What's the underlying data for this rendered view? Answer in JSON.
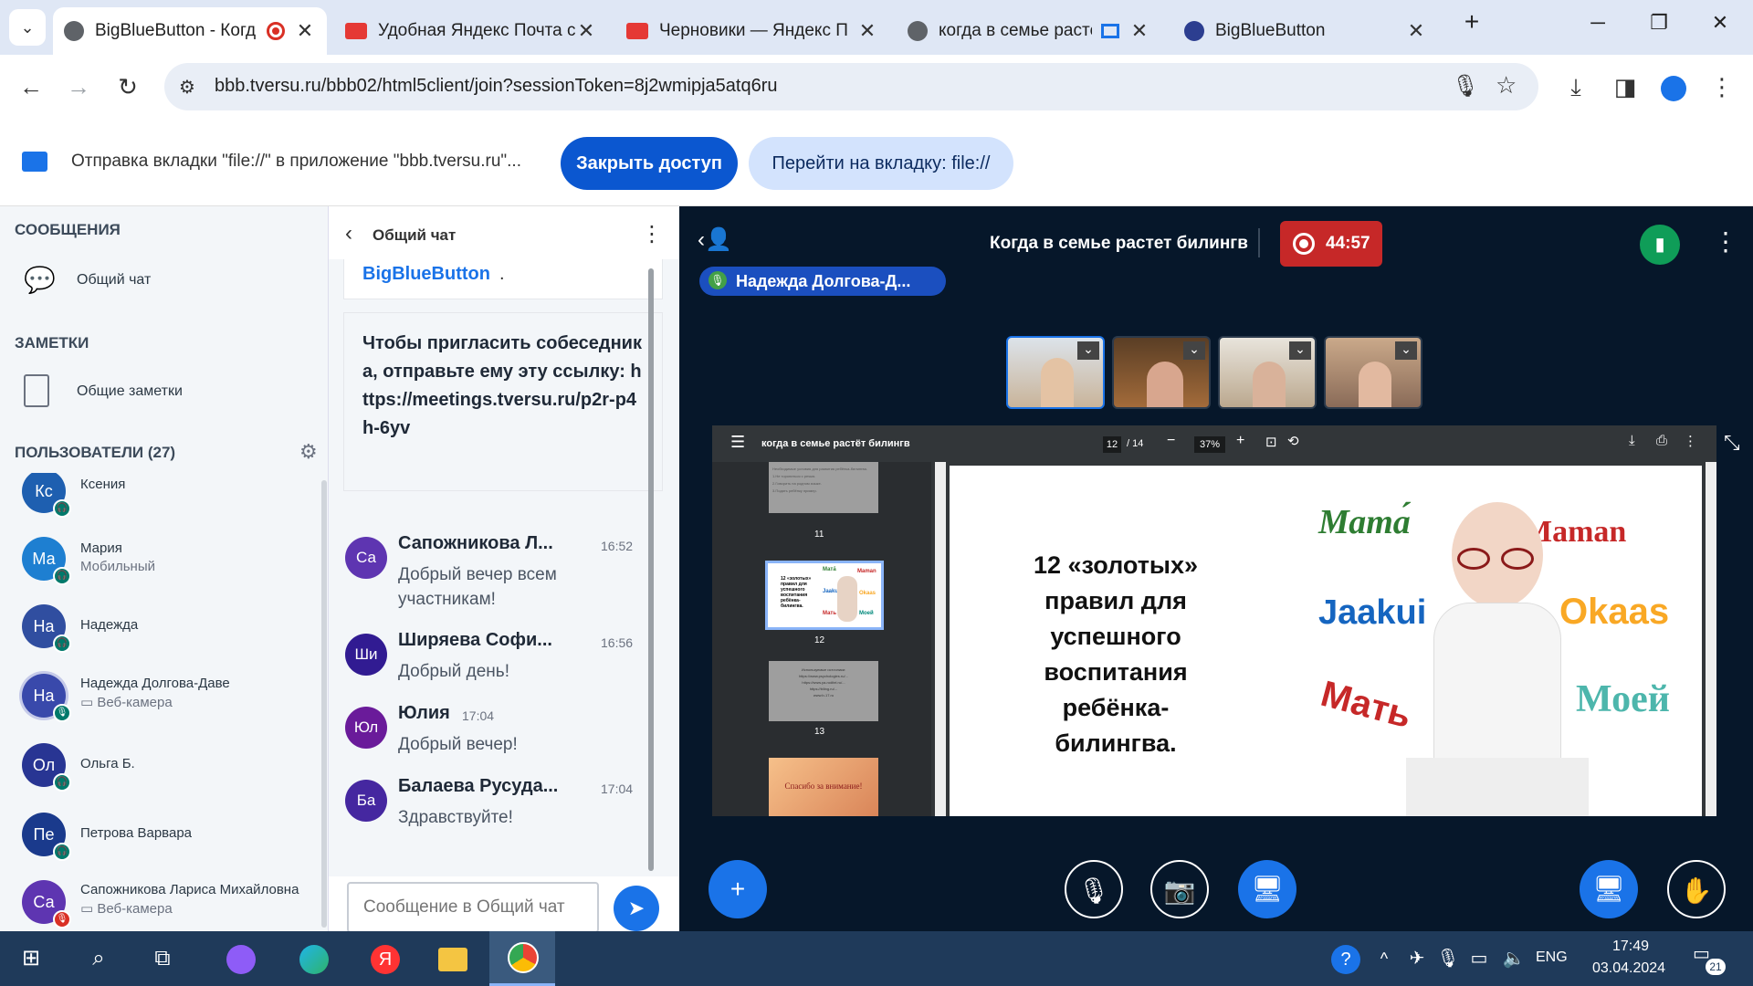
{
  "browser": {
    "tabs": [
      {
        "title": "BigBlueButton - Когд",
        "active": true
      },
      {
        "title": "Удобная Яндекс Почта с"
      },
      {
        "title": "Черновики — Яндекс П"
      },
      {
        "title": "когда в семье растё"
      },
      {
        "title": "BigBlueButton"
      }
    ],
    "url": "bbb.tversu.ru/bbb02/html5client/join?sessionToken=8j2wmipja5atq6ru",
    "new_tab": "+",
    "window_min": "─",
    "window_restore": "❐",
    "window_close": "✕"
  },
  "infobar": {
    "text": "Отправка вкладки \"file://\" в приложение \"bbb.tversu.ru\"...",
    "stop_button": "Закрыть доступ",
    "switch_button": "Перейти на вкладку: file://"
  },
  "sidebar": {
    "messages_title": "СООБЩЕНИЯ",
    "public_chat": "Общий чат",
    "notes_title": "ЗАМЕТКИ",
    "shared_notes": "Общие заметки",
    "users_title": "ПОЛЬЗОВАТЕЛИ (27)",
    "users": [
      {
        "initials": "Кс",
        "name": "Ксения",
        "color": "#1e5fb0",
        "badge": "headset"
      },
      {
        "initials": "Ма",
        "name": "Мария",
        "sub": "Мобильный",
        "color": "#1e7fd1",
        "badge": "headset"
      },
      {
        "initials": "На",
        "name": "Надежда",
        "color": "#304ea0",
        "badge": "headset"
      },
      {
        "initials": "На",
        "name": "Надежда Долгова-Даве",
        "sub": "▭ Веб-камера",
        "color": "#3949ab",
        "badge": "mic"
      },
      {
        "initials": "Ол",
        "name": "Ольга Б.",
        "color": "#283593",
        "badge": "headset"
      },
      {
        "initials": "Пе",
        "name": "Петрова Варвара",
        "color": "#1a3a8c",
        "badge": "headset"
      },
      {
        "initials": "Са",
        "name": "Сапожникова Лариса Михайловна",
        "sub": "▭ Веб-камера",
        "color": "#5e35b1",
        "badge": "mic-off"
      }
    ]
  },
  "chat": {
    "title": "Общий чат",
    "link_tail": "BigBlueButton",
    "invite_text": "Чтобы пригласить собеседника, отправьте ему эту ссылку: https://meetings.tversu.ru/p2r-p4h-6yv",
    "messages": [
      {
        "initials": "Са",
        "name": "Сапожникова Л...",
        "time": "16:52",
        "text": "Добрый вечер всем участникам!",
        "color": "#5e35b1"
      },
      {
        "initials": "Ши",
        "name": "Ширяева Софи...",
        "time": "16:56",
        "text": "Добрый день!",
        "color": "#311b92"
      },
      {
        "initials": "Юл",
        "name": "Юлия",
        "time": "17:04",
        "text": "Добрый вечер!",
        "color": "#6a1b9a"
      },
      {
        "initials": "Ба",
        "name": "Балаева Русуда...",
        "time": "17:04",
        "text": "Здравствуйте!",
        "color": "#4527a0"
      }
    ],
    "input_placeholder": "Сообщение в Общий чат"
  },
  "meeting": {
    "title": "Когда в семье растет билингв",
    "timer": "44:57",
    "speaker": "Надежда Долгова-Д..."
  },
  "pdf": {
    "doc_title": "когда в семье растёт билингв",
    "page": "12",
    "pages": "/ 14",
    "zoom": "37%",
    "thumbs": [
      "11",
      "12",
      "13",
      "14"
    ],
    "slide_text": "12 «золотых» правил для успешного воспитания ребёнка-билингва.",
    "words": [
      "Мата́",
      "Maman",
      "Jaakui",
      "Okaas",
      "Мать",
      "Моей"
    ],
    "thumb11_lines": [
      "Необходимые условия для развития ребёнка-билингва.",
      "1.Не торопиться с речью.",
      "2.Говорить на родном языке.",
      "3.Подать ребёнку пример."
    ],
    "thumb12_lines": [
      "12 «золотых» правил для успешного воспитания ребёнка-билингва."
    ],
    "thumb12_words": [
      "Мата́",
      "Maman",
      "Jaakui",
      "Okaas",
      "Мать",
      "Моей"
    ],
    "thumb13_lines": [
      "Используемые источники:",
      "https://www.psychologies.ru/...",
      "https://www.ya-roditel.ru/...",
      "https://biling.ru/...",
      "www.b-17.ru"
    ],
    "thumb14_text": "Спасибо за внимание!"
  },
  "taskbar": {
    "time": "17:49",
    "date": "03.04.2024",
    "lang": "ENG",
    "notif": "21"
  }
}
